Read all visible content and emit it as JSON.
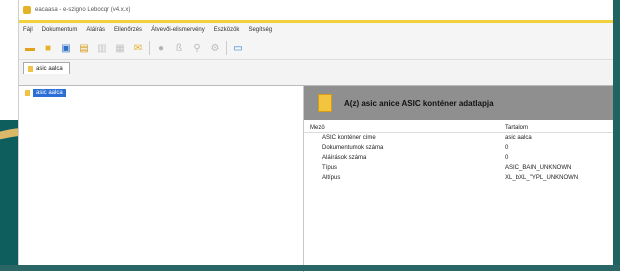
{
  "window": {
    "title": "eacaasa - e-szigno Lebocqr (v4.x.x)"
  },
  "menu": [
    "Fájl",
    "Dokumentum",
    "Aláírás",
    "Ellenőrzés",
    "Átvevői-elismervény",
    "Eszközök",
    "Segítség"
  ],
  "toolbar": {
    "icons": [
      "new-icon",
      "open-folder-icon",
      "save-icon",
      "save-as-icon",
      "sign-icon",
      "verify-icon",
      "mail-icon",
      "timestamp-icon",
      "attach-icon",
      "search-icon",
      "settings-icon",
      "view-icon"
    ]
  },
  "tab": {
    "label": "asic aalca"
  },
  "tree": {
    "selected_label": "asic aalca"
  },
  "details": {
    "title": "A(z) asic anice ASIC konténer adatlapja",
    "col_name": "Mezö",
    "col_value": "Tartalom",
    "rows": [
      {
        "name": "ASIC konténer címe",
        "value": "asic aalca"
      },
      {
        "name": "Dokumentumok száma",
        "value": "0"
      },
      {
        "name": "Aláírások száma",
        "value": "0"
      },
      {
        "name": "Típus",
        "value": "ASIC_BAIN_UNKNOWN"
      },
      {
        "name": "Altípus",
        "value": "XL_bXL_\"YPL_UNKNOWN"
      }
    ]
  },
  "colors": {
    "accent": "#f2d23c",
    "selection": "#2b6fd6",
    "header_gray": "#8f8f8f"
  }
}
